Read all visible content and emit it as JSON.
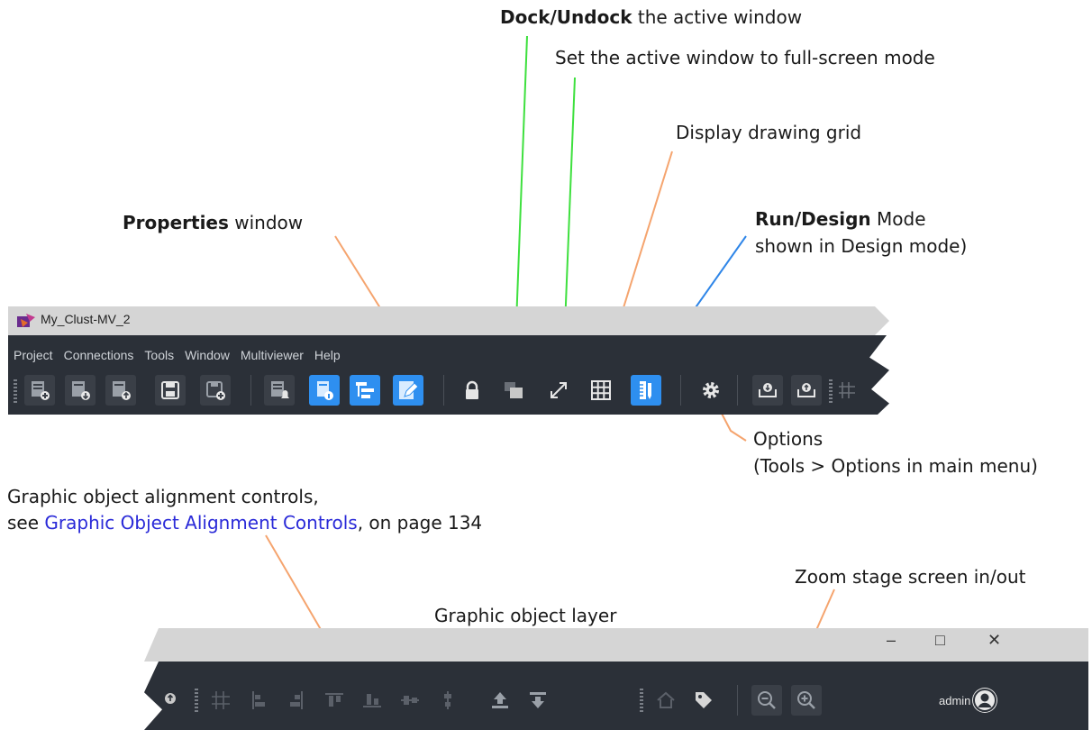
{
  "annotations": {
    "dock_bold": "Dock/Undock",
    "dock_rest": " the active window",
    "fullscreen": "Set the active window to full-screen mode",
    "grid": "Display drawing grid",
    "properties_bold": "Properties",
    "properties_rest": " window",
    "runmode_bold": "Run/Design",
    "runmode_rest": " Mode",
    "runmode_line2": "shown in Design mode)",
    "options_line1": "Options",
    "options_line2": "(Tools > Options in main menu)",
    "align_line1": "Graphic object alignment controls,",
    "align_line2_pre": "see ",
    "align_line2_link": "Graphic Object Alignment Controls",
    "align_line2_post": ", on page 134",
    "zoom": "Zoom stage screen in/out",
    "layer": "Graphic object layer"
  },
  "app": {
    "title": "My_Clust-MV_2",
    "menus": [
      "Project",
      "Connections",
      "Tools",
      "Window",
      "Multiviewer",
      "Help"
    ],
    "user": "admin"
  },
  "window_controls": {
    "minimize": "–",
    "maximize": "□",
    "close": "✕"
  },
  "colors": {
    "toolbar_bg": "#2b3038",
    "active_button": "#2e8ff0",
    "callout_orange": "#f5a46e",
    "callout_green": "#3ee03e",
    "callout_blue": "#2f86e8",
    "link": "#2a2ad8"
  }
}
